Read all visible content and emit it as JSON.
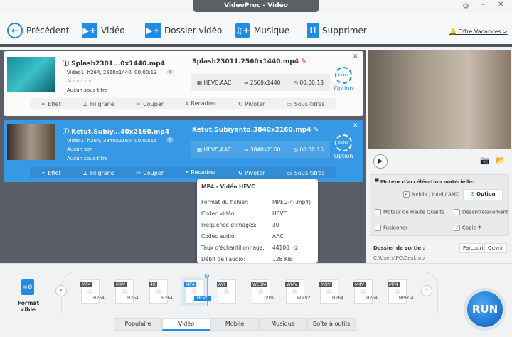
{
  "window": {
    "title": "VideoProc - Vidéo"
  },
  "toolbar": {
    "back": "Précédent",
    "video": "Vidéo",
    "folder": "Dossier vidéo",
    "music": "Musique",
    "delete": "Supprimer",
    "promo": "Offre Vacances >"
  },
  "files": [
    {
      "source_name": "Splash2301...0x1440.mp4",
      "video_info": "Video1: h264, 2560x1440, 00:00:13",
      "audio": "Aucun son",
      "subtitle": "Aucun sous-titre",
      "track_count": "1",
      "output_name": "Splash23011.2560x1440.mp4",
      "codec": "HEVC,AAC",
      "resolution": "2560x1440",
      "duration": "00:00:13",
      "selected": false
    },
    {
      "source_name": "Ketut.Subiy...40x2160.mp4",
      "video_info": "Video1: h264, 3840x2160, 00:00:15",
      "audio": "Aucun son",
      "subtitle": "Aucun sous-titre",
      "track_count": "1",
      "output_name": "Ketut.Subiyanto.3840x2160.mp4",
      "codec": "HEVC,AAC",
      "resolution": "3840x2160",
      "duration": "00:00:15",
      "selected": true
    }
  ],
  "file_actions": {
    "effect": "Effet",
    "watermark": "Filigrane",
    "cut": "Couper",
    "crop": "Recadrer",
    "rotate": "Pivoter",
    "subtitles": "Sous-titres",
    "option": "Option",
    "codec_badge": "codec"
  },
  "tooltip": {
    "title": "MP4 - Vidéo HEVC",
    "rows": [
      {
        "label": "Format du fichier:",
        "value": "MPEG-4(.mp4)"
      },
      {
        "label": "Codec vidéo:",
        "value": "HEVC"
      },
      {
        "label": "Fréquence d'images:",
        "value": "30"
      },
      {
        "label": "Codec audio:",
        "value": "AAC"
      },
      {
        "label": "Taux d'échantillonnage:",
        "value": "44100 Hz"
      },
      {
        "label": "Débit de l'audio:",
        "value": "128 KiB"
      }
    ]
  },
  "settings": {
    "hw_title": "Moteur d'accélération matérielle:",
    "hw_option": "Nvidia / Intel / AMD",
    "hw_checked": true,
    "option_btn": "Option",
    "high_quality": "Moteur de Haute Qualité",
    "high_quality_checked": false,
    "deinterlace": "Désentrelacement",
    "deinterlace_checked": false,
    "merge": "Fusionner",
    "merge_checked": false,
    "copy": "Copie",
    "copy_checked": true,
    "help": "?"
  },
  "output": {
    "label": "Dossier de sortie :",
    "path": "C:\\Users\\PC\\Desktop",
    "browse": "Parcourir",
    "open": "Ouvrir"
  },
  "formats": {
    "target_label": "Format cible",
    "items": [
      {
        "tag": "MP4",
        "sub": "H264"
      },
      {
        "tag": "MKV",
        "sub": "H264"
      },
      {
        "tag": "4K",
        "sub": "H264"
      },
      {
        "tag": "MP4",
        "sub": "HEVC",
        "selected": true
      },
      {
        "tag": "AVI",
        "sub": ""
      },
      {
        "tag": "WEBM",
        "sub": "VP8"
      },
      {
        "tag": "WMV",
        "sub": "WMV2"
      },
      {
        "tag": "MOV",
        "sub": "H264"
      },
      {
        "tag": "M4V",
        "sub": "H264"
      },
      {
        "tag": "MP4",
        "sub": "MPEG4"
      }
    ]
  },
  "tabs": [
    "Populaire",
    "Vidéo",
    "Mobile",
    "Musique",
    "Boîte à outils"
  ],
  "active_tab": "Vidéo",
  "run": "RUN",
  "colors": {
    "accent": "#1f8ce6",
    "selected_card": "#3799e6",
    "panel": "#5a5e68",
    "promo": "#f0501e"
  }
}
